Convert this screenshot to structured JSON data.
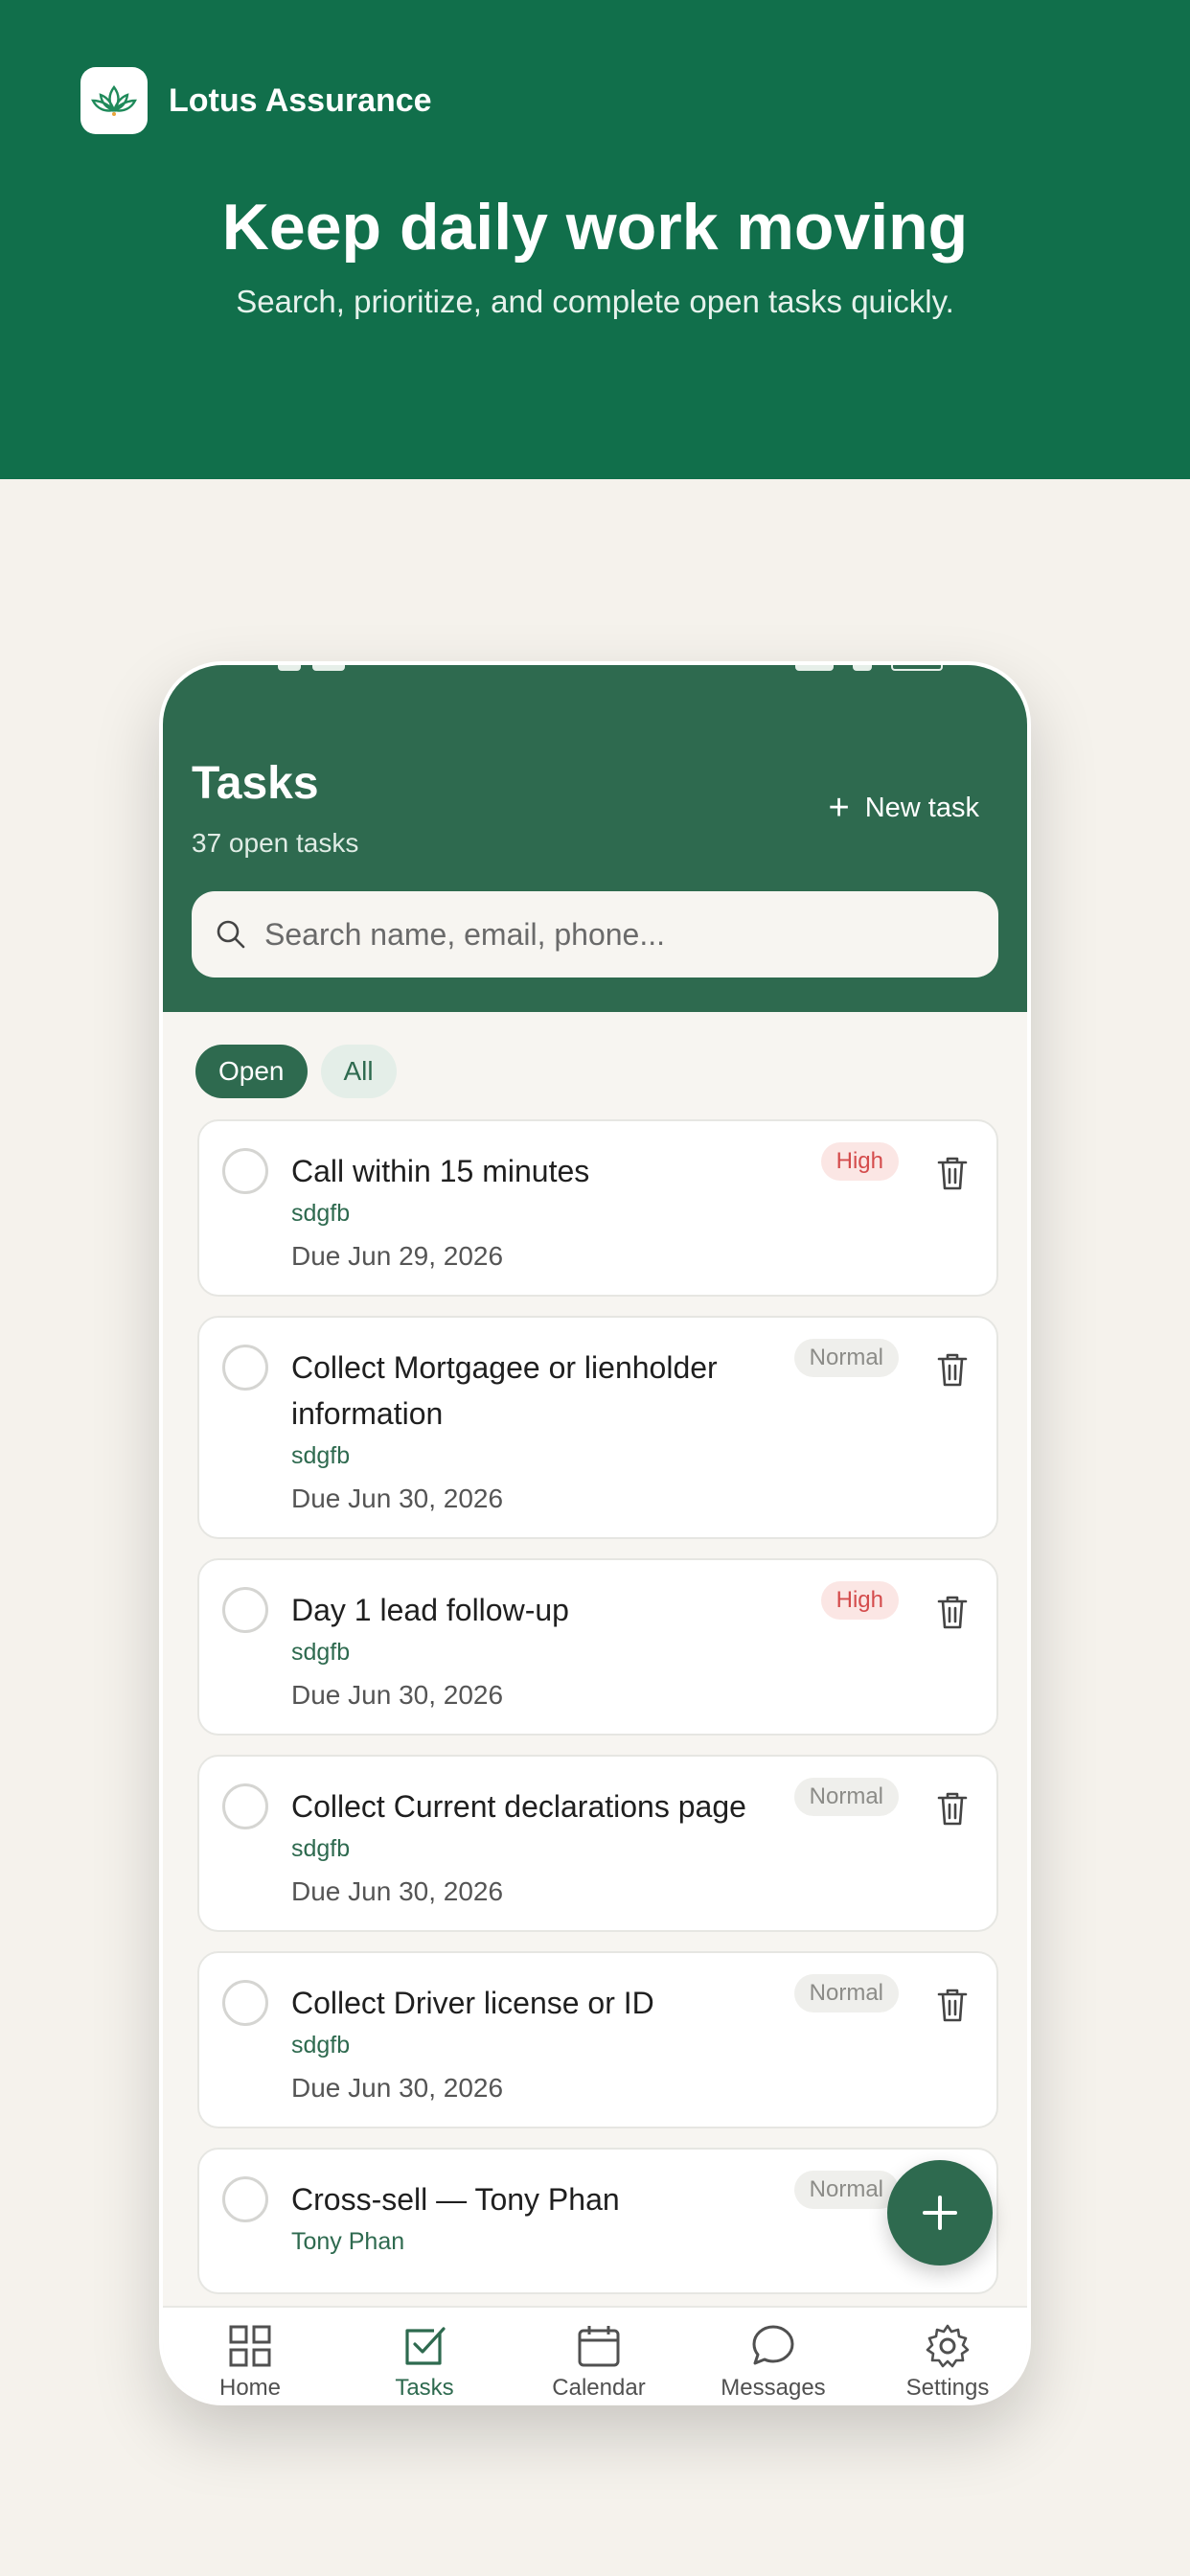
{
  "brand": {
    "name": "Lotus Assurance",
    "logo_icon": "lotus-icon"
  },
  "promo": {
    "title": "Keep daily work moving",
    "subtitle": "Search, prioritize, and complete open tasks quickly."
  },
  "app": {
    "title": "Tasks",
    "count_label": "37 open tasks",
    "new_task_label": "New task",
    "search_placeholder": "Search name, email, phone...",
    "filters": [
      {
        "label": "Open",
        "active": true
      },
      {
        "label": "All",
        "active": false
      }
    ],
    "tasks": [
      {
        "title": "Call within 15 minutes",
        "owner": "sdgfb",
        "due": "Due Jun 29, 2026",
        "priority": "High"
      },
      {
        "title": "Collect Mortgagee or lienholder information",
        "owner": "sdgfb",
        "due": "Due Jun 30, 2026",
        "priority": "Normal"
      },
      {
        "title": "Day 1 lead follow-up",
        "owner": "sdgfb",
        "due": "Due Jun 30, 2026",
        "priority": "High"
      },
      {
        "title": "Collect Current declarations page",
        "owner": "sdgfb",
        "due": "Due Jun 30, 2026",
        "priority": "Normal"
      },
      {
        "title": "Collect Driver license or ID",
        "owner": "sdgfb",
        "due": "Due Jun 30, 2026",
        "priority": "Normal"
      },
      {
        "title": "Cross-sell — Tony Phan",
        "owner": "Tony Phan",
        "due": "",
        "priority": "Normal"
      }
    ],
    "tabs": [
      {
        "label": "Home",
        "icon": "grid-icon",
        "active": false
      },
      {
        "label": "Tasks",
        "icon": "checkbox-icon",
        "active": true
      },
      {
        "label": "Calendar",
        "icon": "calendar-icon",
        "active": false
      },
      {
        "label": "Messages",
        "icon": "chat-bubble-icon",
        "active": false
      },
      {
        "label": "Settings",
        "icon": "gear-icon",
        "active": false
      }
    ]
  },
  "colors": {
    "promo_green": "#116f4b",
    "app_green": "#2e6a4f",
    "high_red": "#d44c4c",
    "background": "#f5f2ec"
  }
}
